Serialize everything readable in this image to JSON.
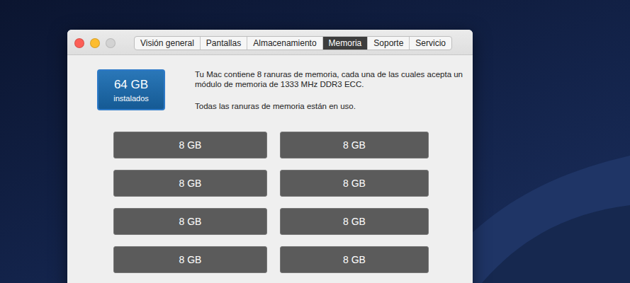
{
  "window": {
    "controls": [
      {
        "kind": "close",
        "disabled": false,
        "color": "#fc5f57"
      },
      {
        "kind": "minimize",
        "disabled": false,
        "color": "#fdbc2e"
      },
      {
        "kind": "zoom",
        "disabled": true,
        "color": "#cfcfcf"
      }
    ]
  },
  "tabs": [
    {
      "label": "Visión general",
      "selected": false
    },
    {
      "label": "Pantallas",
      "selected": false
    },
    {
      "label": "Almacenamiento",
      "selected": false
    },
    {
      "label": "Memoria",
      "selected": true
    },
    {
      "label": "Soporte",
      "selected": false
    },
    {
      "label": "Servicio",
      "selected": false
    }
  ],
  "summary": {
    "size": "64 GB",
    "label": "instalados"
  },
  "description": "Tu Mac contiene 8 ranuras de memoria, cada una de las cuales acepta un módulo de memoria de 1333 MHz DDR3 ECC.",
  "status": "Todas las ranuras de memoria están en uso.",
  "slots": [
    {
      "label": "8 GB"
    },
    {
      "label": "8 GB"
    },
    {
      "label": "8 GB"
    },
    {
      "label": "8 GB"
    },
    {
      "label": "8 GB"
    },
    {
      "label": "8 GB"
    },
    {
      "label": "8 GB"
    },
    {
      "label": "8 GB"
    }
  ]
}
